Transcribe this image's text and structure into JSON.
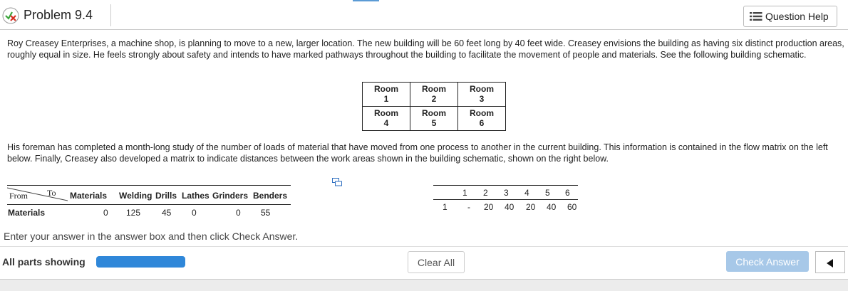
{
  "header": {
    "title": "Problem 9.4",
    "help_label": "Question Help"
  },
  "problem": {
    "intro": "Roy Creasey Enterprises, a machine shop, is planning to move to a new, larger location. The new building will be 60 feet long by 40 feet wide. Creasey envisions the building as having six distinct production areas, roughly equal in size. He feels strongly about safety and intends to have marked pathways throughout the building to facilitate the movement of people and materials. See the following building schematic.",
    "rooms": [
      {
        "word": "Room",
        "num": "1"
      },
      {
        "word": "Room",
        "num": "2"
      },
      {
        "word": "Room",
        "num": "3"
      },
      {
        "word": "Room",
        "num": "4"
      },
      {
        "word": "Room",
        "num": "5"
      },
      {
        "word": "Room",
        "num": "6"
      }
    ],
    "followup": "His foreman has completed a month-long study of the number of loads of material that have moved from one process to another in the current building. This information is contained in the flow matrix on the left below. Finally, Creasey also developed a matrix to indicate distances between the work areas shown in the building schematic, shown on the right below."
  },
  "flow_matrix": {
    "from_label": "From",
    "to_label": "To",
    "columns": [
      "Materials",
      "Welding",
      "Drills",
      "Lathes",
      "Grinders",
      "Benders"
    ],
    "row_label": "Materials",
    "row_values": [
      "0",
      "125",
      "45",
      "0",
      "0",
      "55"
    ]
  },
  "distance_matrix": {
    "columns": [
      "1",
      "2",
      "3",
      "4",
      "5",
      "6"
    ],
    "row_label": "1",
    "row_values": [
      "-",
      "20",
      "40",
      "20",
      "40",
      "60"
    ]
  },
  "instruction": "Enter your answer in the answer box and then click Check Answer.",
  "footer": {
    "all_parts": "All parts showing",
    "progress": 1.0,
    "clear_all": "Clear All",
    "check_answer": "Check Answer"
  }
}
